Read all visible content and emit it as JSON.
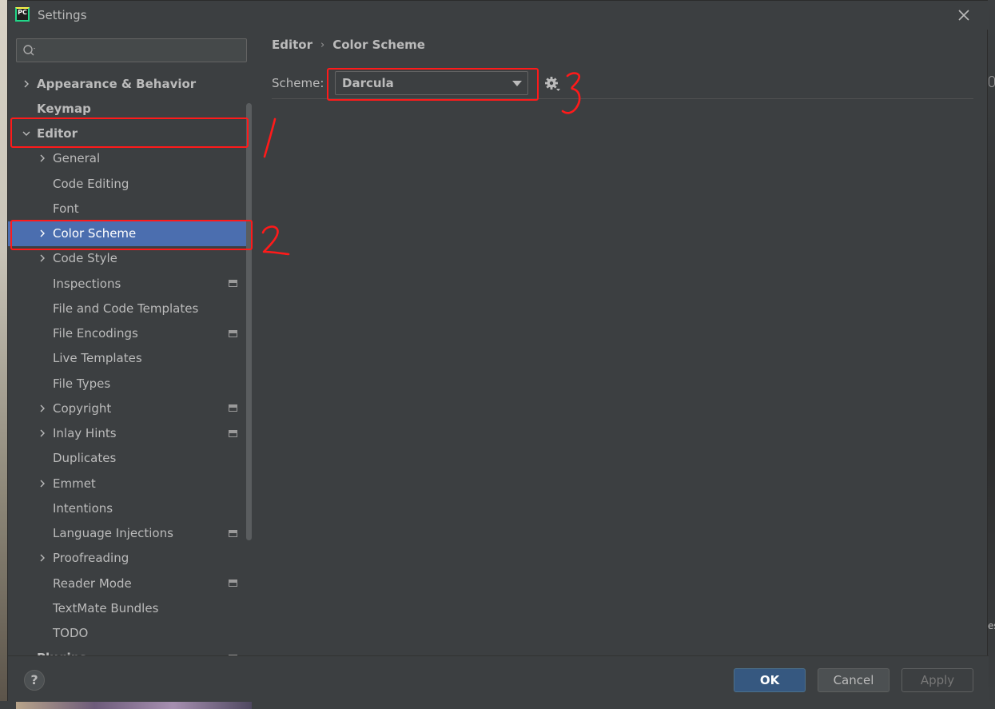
{
  "window": {
    "title": "Settings",
    "app_icon_text": "PC"
  },
  "search": {
    "placeholder": "",
    "value": ""
  },
  "tree": [
    {
      "label": "Appearance & Behavior",
      "level": 0,
      "expandable": true,
      "expanded": false,
      "top": true
    },
    {
      "label": "Keymap",
      "level": 0,
      "expandable": false,
      "top": true
    },
    {
      "label": "Editor",
      "level": 0,
      "expandable": true,
      "expanded": true,
      "top": true
    },
    {
      "label": "General",
      "level": 1,
      "expandable": true
    },
    {
      "label": "Code Editing",
      "level": 1,
      "expandable": false
    },
    {
      "label": "Font",
      "level": 1,
      "expandable": false
    },
    {
      "label": "Color Scheme",
      "level": 1,
      "expandable": true,
      "selected": true
    },
    {
      "label": "Code Style",
      "level": 1,
      "expandable": true
    },
    {
      "label": "Inspections",
      "level": 1,
      "expandable": false,
      "project_icon": true
    },
    {
      "label": "File and Code Templates",
      "level": 1,
      "expandable": false
    },
    {
      "label": "File Encodings",
      "level": 1,
      "expandable": false,
      "project_icon": true
    },
    {
      "label": "Live Templates",
      "level": 1,
      "expandable": false
    },
    {
      "label": "File Types",
      "level": 1,
      "expandable": false
    },
    {
      "label": "Copyright",
      "level": 1,
      "expandable": true,
      "project_icon": true
    },
    {
      "label": "Inlay Hints",
      "level": 1,
      "expandable": true,
      "project_icon": true
    },
    {
      "label": "Duplicates",
      "level": 1,
      "expandable": false
    },
    {
      "label": "Emmet",
      "level": 1,
      "expandable": true
    },
    {
      "label": "Intentions",
      "level": 1,
      "expandable": false
    },
    {
      "label": "Language Injections",
      "level": 1,
      "expandable": false,
      "project_icon": true
    },
    {
      "label": "Proofreading",
      "level": 1,
      "expandable": true
    },
    {
      "label": "Reader Mode",
      "level": 1,
      "expandable": false,
      "project_icon": true
    },
    {
      "label": "TextMate Bundles",
      "level": 1,
      "expandable": false
    },
    {
      "label": "TODO",
      "level": 1,
      "expandable": false
    },
    {
      "label": "Plugins",
      "level": 0,
      "expandable": false,
      "top": true,
      "project_icon": true
    }
  ],
  "breadcrumb": {
    "first": "Editor",
    "separator": "›",
    "second": "Color Scheme"
  },
  "scheme": {
    "label": "Scheme:",
    "value": "Darcula"
  },
  "footer": {
    "help": "?",
    "ok": "OK",
    "cancel": "Cancel",
    "apply": "Apply"
  },
  "annotations": {
    "one": "1",
    "two": "2",
    "three": "3",
    "color": "#ff1a1a"
  },
  "edge_text": "es",
  "colors": {
    "background": "#3c3f41",
    "selection": "#4b6eaf",
    "text": "#bbbbbb",
    "ok_button": "#365880",
    "annotation": "#ff1a1a"
  }
}
